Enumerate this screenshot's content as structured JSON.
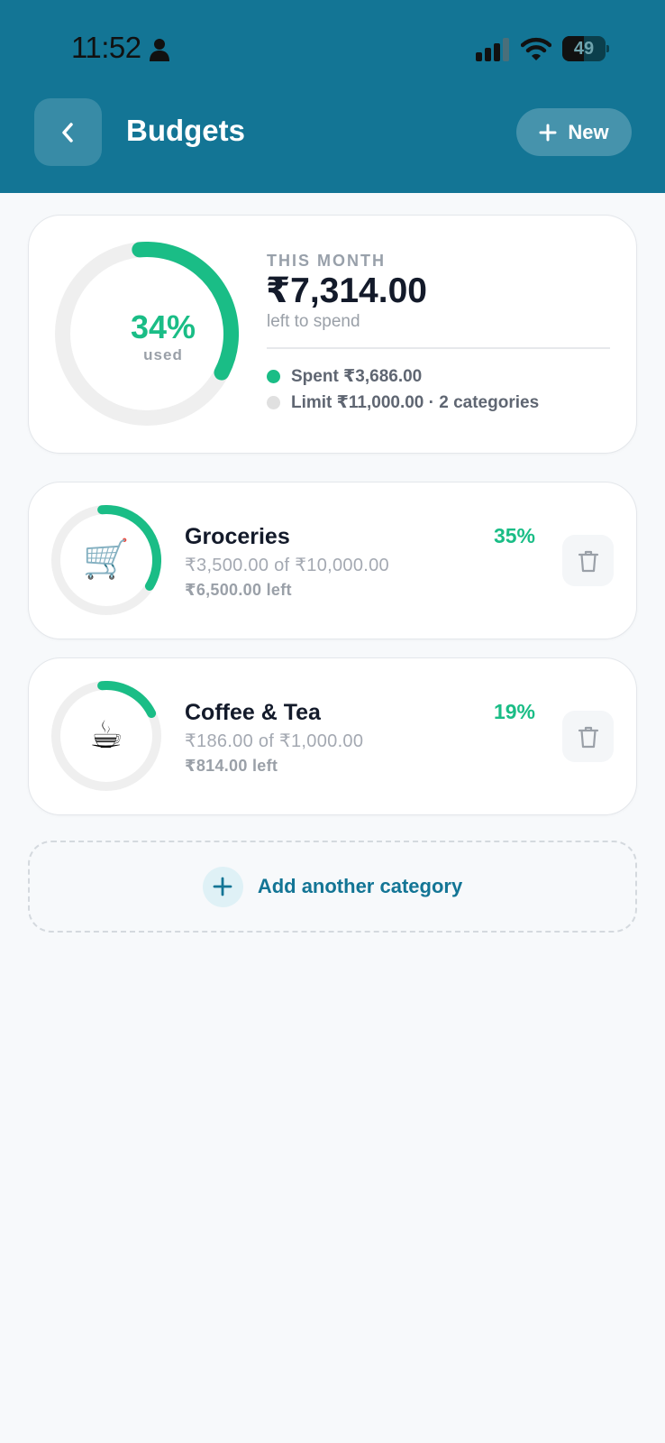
{
  "status_bar": {
    "time": "11:52",
    "battery": "49",
    "battery_level": 0.49
  },
  "header": {
    "title": "Budgets",
    "back_icon": "chevron-left-icon",
    "new_label": "New",
    "new_icon": "plus-icon"
  },
  "summary": {
    "percent": "34%",
    "percent_value": 34,
    "used_label": "used",
    "period_label": "THIS MONTH",
    "left_amount": "₹7,314.00",
    "left_caption": "left to spend",
    "spent_label": "Spent ₹3,686.00",
    "limit_label": "Limit ₹11,000.00 · 2 categories"
  },
  "categories": [
    {
      "name": "Groceries",
      "emoji": "🛒",
      "percent": "35%",
      "percent_value": 35,
      "amount": "₹3,500.00 of ₹10,000.00",
      "left": "₹6,500.00 left"
    },
    {
      "name": "Coffee & Tea",
      "emoji": "☕",
      "percent": "19%",
      "percent_value": 19,
      "amount": "₹186.00 of ₹1,000.00",
      "left": "₹814.00 left"
    }
  ],
  "add_category_label": "Add another category",
  "colors": {
    "header": "#137595",
    "accent_green": "#1abd86",
    "track": "#efefef",
    "limit_dot": "#e0e0e0"
  }
}
